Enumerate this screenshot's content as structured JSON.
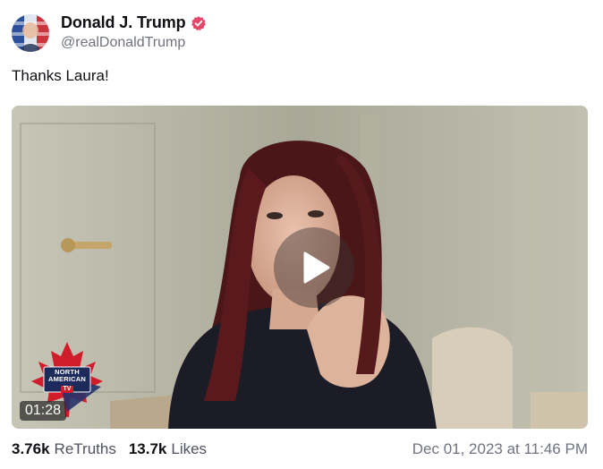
{
  "author": {
    "display_name": "Donald J. Trump",
    "handle": "@realDonaldTrump",
    "verified": true,
    "badge_color": "#e5476b"
  },
  "post": {
    "text": "Thanks Laura!"
  },
  "video": {
    "duration": "01:28",
    "watermark": [
      "NORTH",
      "AMERICAN",
      "TV"
    ]
  },
  "stats": {
    "retruths_count": "3.76k",
    "retruths_label": "ReTruths",
    "likes_count": "13.7k",
    "likes_label": "Likes"
  },
  "timestamp": "Dec 01, 2023 at 11:46 PM"
}
